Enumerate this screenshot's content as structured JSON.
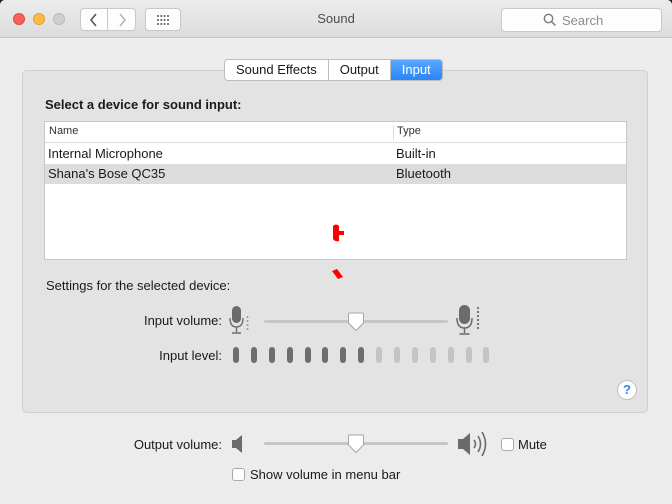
{
  "window": {
    "title": "Sound",
    "search_placeholder": "Search"
  },
  "tabs": [
    {
      "label": "Sound Effects",
      "active": false
    },
    {
      "label": "Output",
      "active": false
    },
    {
      "label": "Input",
      "active": true
    }
  ],
  "device_section": {
    "heading": "Select a device for sound input:",
    "columns": {
      "name": "Name",
      "type": "Type"
    },
    "rows": [
      {
        "name": "Internal Microphone",
        "type": "Built-in",
        "selected": false
      },
      {
        "name": "Shana's Bose QC35",
        "type": "Bluetooth",
        "selected": true
      }
    ]
  },
  "settings": {
    "label": "Settings for the selected device:",
    "input_volume_label": "Input volume:",
    "input_volume_fraction": 0.5,
    "input_level_label": "Input level:",
    "input_level_total": 15,
    "input_level_lit": 8
  },
  "help_label": "?",
  "output": {
    "volume_label": "Output volume:",
    "volume_fraction": 0.5,
    "mute_label": "Mute",
    "mute_checked": false,
    "menu_bar_label": "Show volume in menu bar",
    "menu_bar_checked": false
  },
  "colors": {
    "accent": "#2a85f6",
    "level_lit": "#6e6e6e",
    "level_dim": "#c4c4c4",
    "glitch": "#ff0000"
  },
  "icons": [
    "chevron-left-icon",
    "chevron-right-icon",
    "grid-icon",
    "search-icon",
    "microphone-icon",
    "speaker-icon",
    "speaker-loud-icon"
  ]
}
